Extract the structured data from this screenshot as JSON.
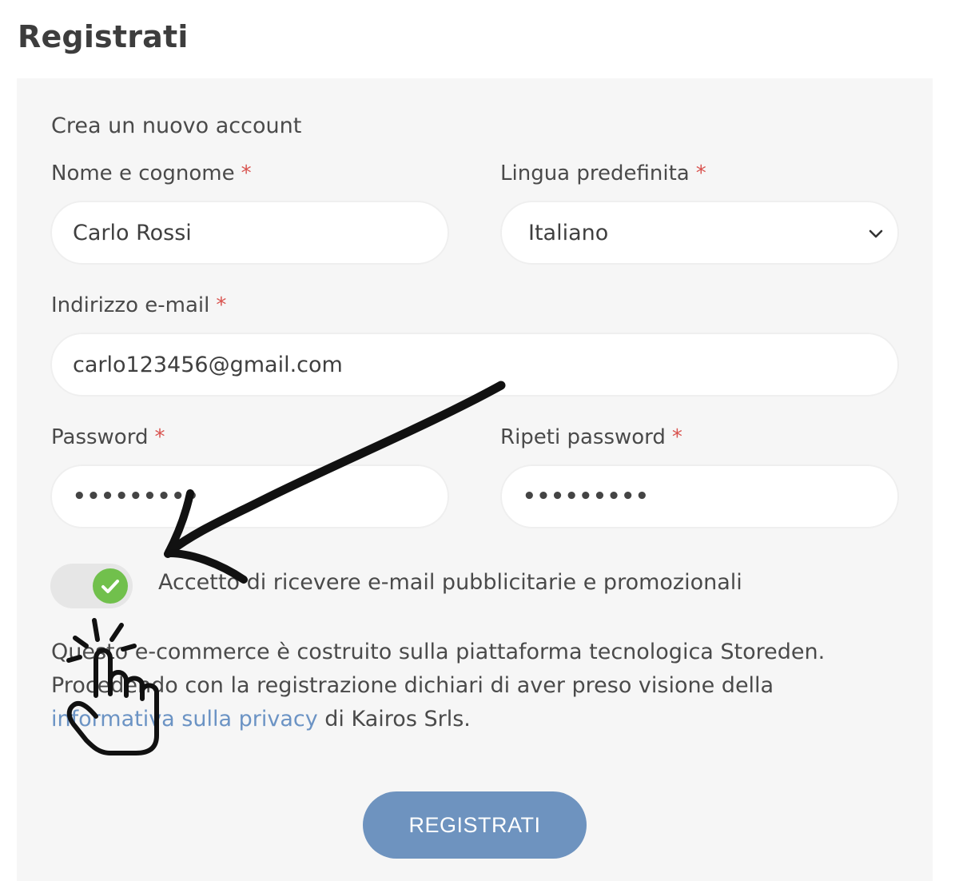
{
  "page": {
    "title": "Registrati"
  },
  "form": {
    "subtitle": "Crea un nuovo account",
    "required_mark": "*",
    "name": {
      "label": "Nome e cognome",
      "value": "Carlo Rossi"
    },
    "language": {
      "label": "Lingua predefinita",
      "selected": "Italiano",
      "icon": "chevron-down-icon"
    },
    "email": {
      "label": "Indirizzo e-mail",
      "value": "carlo123456@gmail.com"
    },
    "password": {
      "label": "Password",
      "masked": "•••••••••"
    },
    "repeat_password": {
      "label": "Ripeti password",
      "masked": "•••••••••"
    },
    "newsletter": {
      "label": "Accetto di ricevere e-mail pubblicitarie e promozionali",
      "checked": true,
      "icon": "check-icon"
    },
    "legal": {
      "line1": "Questo e-commerce è costruito sulla piattaforma tecnologica Storeden.",
      "line2": "Procedendo con la registrazione dichiari di aver preso visione della",
      "link_text": "informativa sulla privacy",
      "line3_suffix": " di Kairos Srls."
    },
    "submit_label": "REGISTRATI"
  },
  "annotations": {
    "arrow": "arrow-annotation-icon",
    "hand": "pointing-hand-icon"
  },
  "colors": {
    "accent": "#6e93bf",
    "toggle_on": "#71c04c",
    "required": "#d9534f",
    "link": "#6b93c4",
    "panel": "#f6f6f6"
  }
}
